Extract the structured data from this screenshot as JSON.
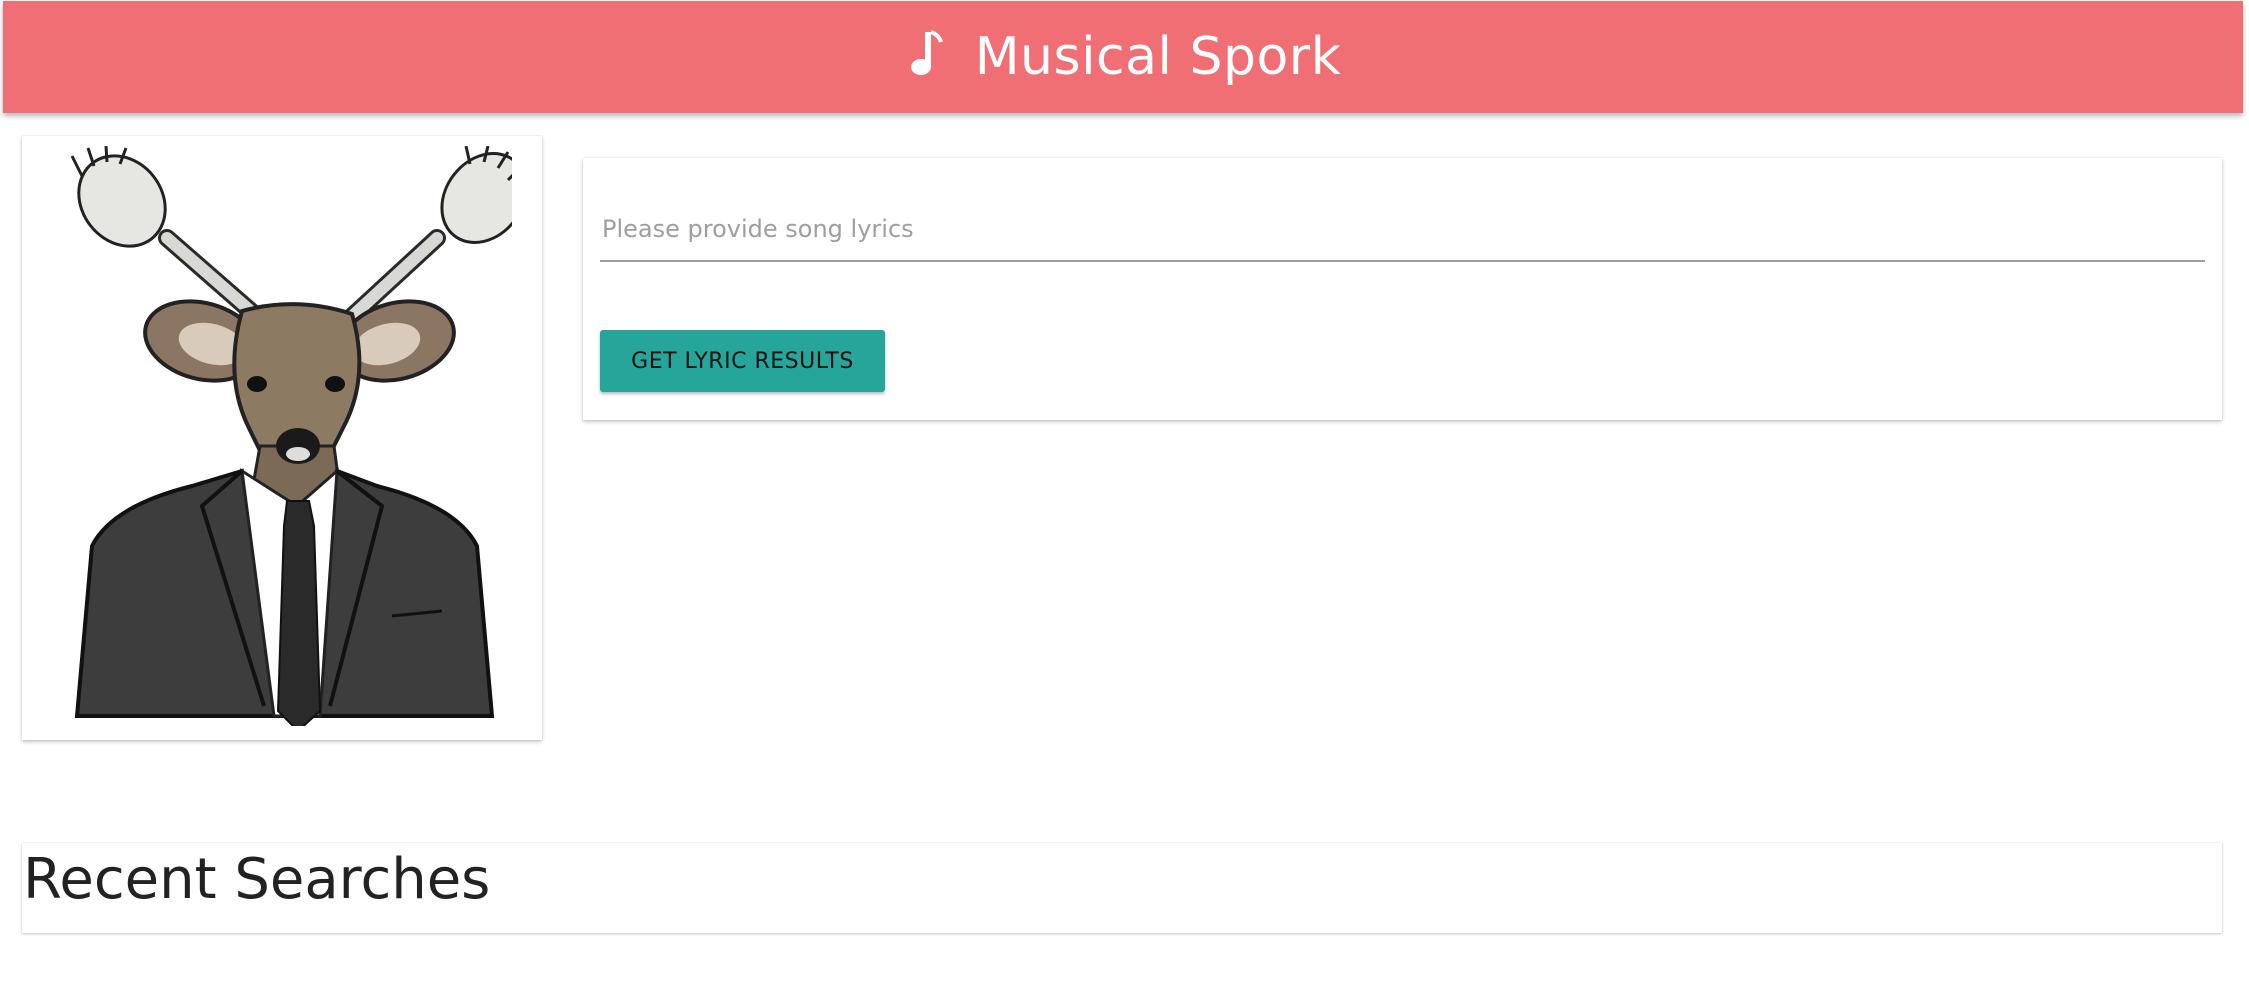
{
  "header": {
    "title": "Musical Spork",
    "icon": "music-note-icon",
    "color": "#ef6f75"
  },
  "illustration": {
    "name": "deer-in-suit-with-spork-antlers"
  },
  "search": {
    "placeholder": "Please provide song lyrics",
    "value": "",
    "button_label": "GET LYRIC RESULTS",
    "button_color": "#26a69a"
  },
  "recent": {
    "heading": "Recent Searches"
  }
}
